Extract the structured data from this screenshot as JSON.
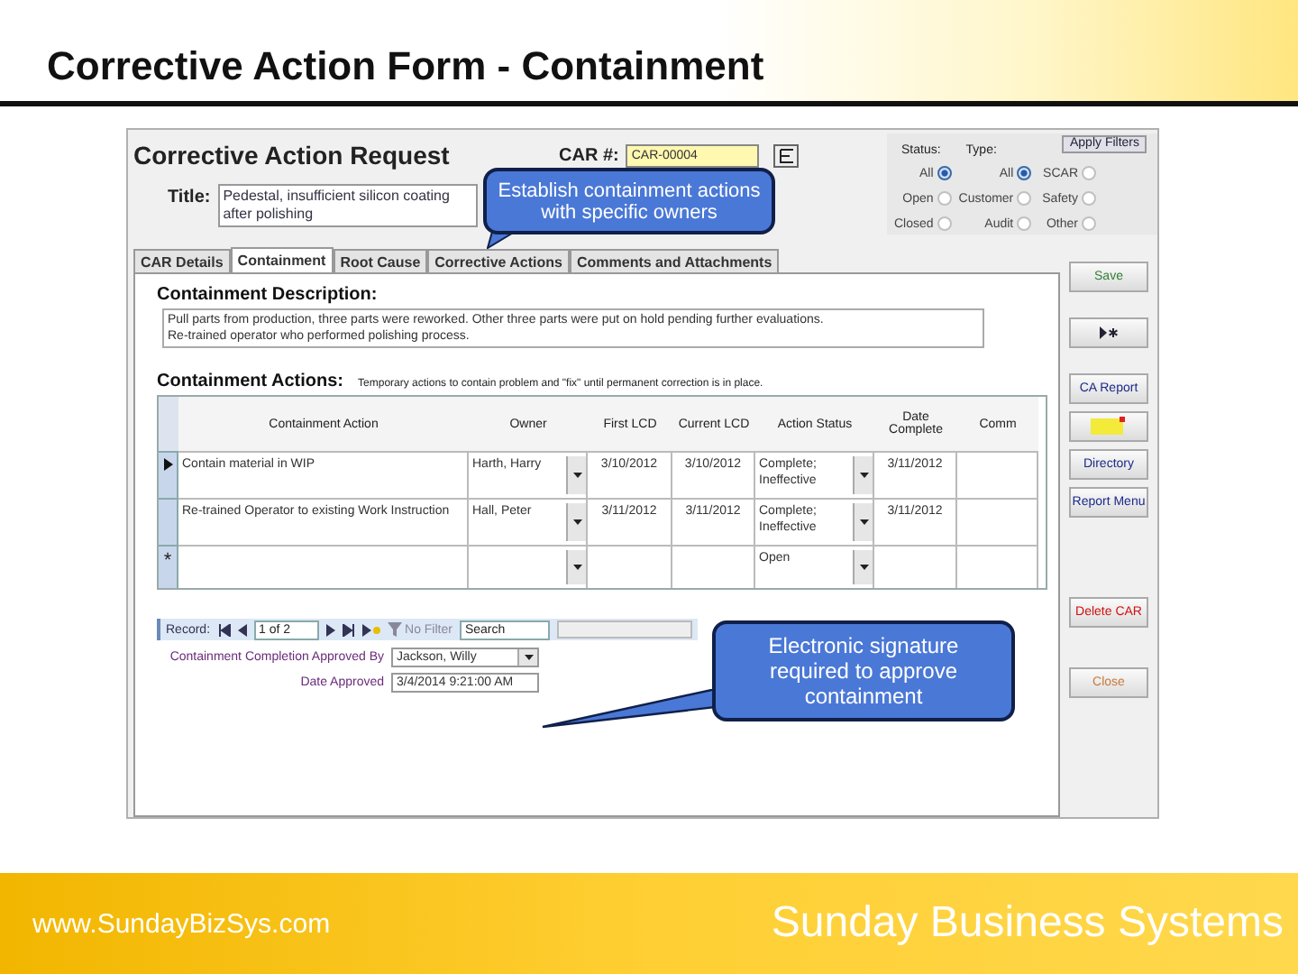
{
  "slide": {
    "title": "Corrective Action Form - Containment",
    "website": "www.SundayBizSys.com",
    "company": "Sunday Business Systems"
  },
  "form": {
    "heading": "Corrective Action Request",
    "car_label": "CAR #:",
    "car_number": "CAR-00004",
    "title_label": "Title:",
    "title_value": "Pedestal, insufficient silicon coating after polishing"
  },
  "filters": {
    "apply_button": "Apply Filters",
    "groups": [
      {
        "label": "Status:",
        "options": [
          {
            "label": "All",
            "selected": true
          },
          {
            "label": "Open",
            "selected": false
          },
          {
            "label": "Closed",
            "selected": false
          }
        ]
      },
      {
        "label": "Type:",
        "options": [
          {
            "label": "All",
            "selected": true
          },
          {
            "label": "Customer",
            "selected": false
          },
          {
            "label": "Audit",
            "selected": false
          },
          {
            "label": "SCAR",
            "selected": false
          },
          {
            "label": "Safety",
            "selected": false
          },
          {
            "label": "Other",
            "selected": false
          }
        ]
      }
    ]
  },
  "tabs": [
    {
      "label": "CAR Details",
      "selected": false
    },
    {
      "label": "Containment",
      "selected": true
    },
    {
      "label": "Root Cause",
      "selected": false
    },
    {
      "label": "Corrective Actions",
      "selected": false
    },
    {
      "label": "Comments and Attachments",
      "selected": false
    }
  ],
  "containment": {
    "description_label": "Containment Description:",
    "description": [
      "Pull parts from production, three parts were reworked. Other three parts were put on hold pending further evaluations.",
      "Re-trained operator who performed polishing process."
    ],
    "actions_label": "Containment Actions:",
    "actions_note": "Temporary actions to contain problem and \"fix\" until permanent correction is in place."
  },
  "grid": {
    "columns": [
      "Containment Action",
      "Owner",
      "First LCD",
      "Current LCD",
      "Action Status",
      "Date Complete",
      "Comm"
    ],
    "rows": [
      {
        "kind": "current",
        "action": "Contain material in WIP",
        "owner": "Harth, Harry",
        "first_lcd": "3/10/2012",
        "current_lcd": "3/10/2012",
        "status": "Complete; Ineffective",
        "date_complete": "3/11/2012"
      },
      {
        "kind": "normal",
        "action": "Re-trained Operator to existing Work Instruction",
        "owner": "Hall, Peter",
        "first_lcd": "3/11/2012",
        "current_lcd": "3/11/2012",
        "status": "Complete; Ineffective",
        "date_complete": "3/11/2012"
      },
      {
        "kind": "new",
        "marker": "*",
        "status": "Open"
      }
    ]
  },
  "navigation": {
    "label": "Record:",
    "position": "1 of 2",
    "filter": "No Filter",
    "search_placeholder": "Search"
  },
  "approval": [
    {
      "kind": "dropdown",
      "label": "Containment Completion Approved By",
      "value": "Jackson, Willy"
    },
    {
      "kind": "text",
      "label": "Date Approved",
      "value": "3/4/2014 9:21:00 AM"
    }
  ],
  "side_buttons": [
    {
      "kind": "text",
      "label": "Save",
      "color": "#2e7d32"
    },
    {
      "kind": "new-record"
    },
    {
      "kind": "text",
      "label": "CA Report",
      "color": "#1a2a8a"
    },
    {
      "kind": "highlighter"
    },
    {
      "kind": "text",
      "label": "Directory",
      "color": "#1a2a8a"
    },
    {
      "kind": "text",
      "label": "Report Menu",
      "color": "#1a2a8a"
    },
    {
      "kind": "text",
      "label": "Delete CAR",
      "color": "#d01010"
    },
    {
      "kind": "text",
      "label": "Close",
      "color": "#c87a3a"
    }
  ],
  "callouts": [
    {
      "text": "Establish containment actions with specific owners"
    },
    {
      "text": "Electronic signature required to approve containment"
    }
  ]
}
